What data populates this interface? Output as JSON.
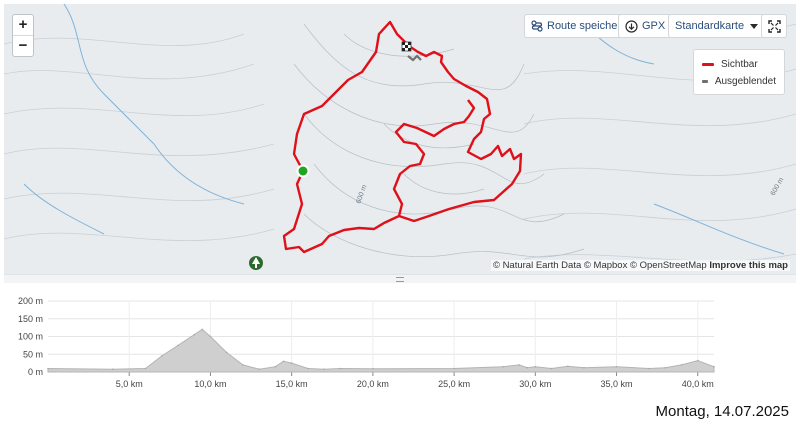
{
  "map": {
    "zoom_in": "+",
    "zoom_out": "−",
    "route_save": "Route speichern",
    "gpx": "GPX",
    "map_style": "Standardkarte",
    "legend": {
      "visible": "Sichtbar",
      "hidden": "Ausgeblendet",
      "visible_color": "#e0101a",
      "hidden_color": "#707070"
    },
    "contour_labels": [
      "600 m",
      "600 m"
    ],
    "attribution": {
      "text": "© Natural Earth Data © Mapbox © OpenStreetMap",
      "link": "Improve this map"
    }
  },
  "profile": {
    "y_ticks": [
      "200 m",
      "150 m",
      "100 m",
      "50 m",
      "0 m"
    ],
    "x_ticks": [
      "5,0 km",
      "10,0 km",
      "15,0 km",
      "20,0 km",
      "25,0 km",
      "30,0 km",
      "35,0 km",
      "40,0 km"
    ]
  },
  "chart_data": {
    "type": "area",
    "x_unit": "km",
    "y_unit": "m",
    "ylim": [
      0,
      200
    ],
    "xlim": [
      0,
      41
    ],
    "x": [
      0,
      4,
      6,
      7,
      8,
      9,
      9.5,
      10,
      11,
      12,
      13,
      14,
      14.5,
      15,
      16,
      17,
      18,
      20,
      25,
      28,
      29,
      29.5,
      30,
      31,
      32,
      33,
      35,
      37,
      38,
      39,
      40,
      41
    ],
    "y": [
      10,
      8,
      10,
      45,
      75,
      105,
      120,
      100,
      55,
      20,
      8,
      15,
      30,
      25,
      10,
      8,
      10,
      9,
      10,
      15,
      20,
      12,
      15,
      10,
      16,
      12,
      15,
      10,
      12,
      20,
      32,
      15
    ]
  },
  "footer": {
    "date": "Montag, 14.07.2025"
  }
}
